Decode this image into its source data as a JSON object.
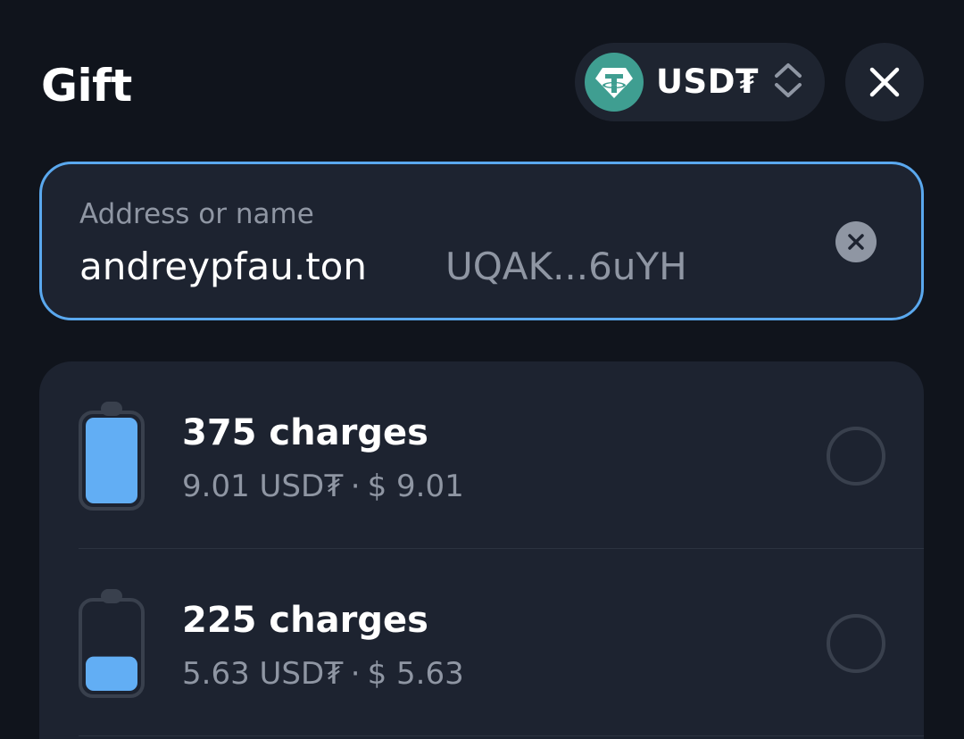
{
  "header": {
    "title": "Gift",
    "currency": "USD₮",
    "token_color": "#3f9e91",
    "currency_icon": "tether-icon",
    "switch_icon": "chevron-up-down-icon",
    "close_icon": "close-icon"
  },
  "address": {
    "placeholder": "Address or name",
    "name": "andreypfau.ton",
    "short_address": "UQAK...6uYH",
    "clear_icon": "clear-icon",
    "focus_color": "#5aa8ee"
  },
  "options": [
    {
      "title": "375 charges",
      "amount": "9.01 USD₮",
      "separator": "·",
      "fiat": "$ 9.01",
      "battery_level": 1.0,
      "selected": false
    },
    {
      "title": "225 charges",
      "amount": "5.63 USD₮",
      "separator": "·",
      "fiat": "$ 5.63",
      "battery_level": 0.4,
      "selected": false
    }
  ],
  "colors": {
    "background": "#10141c",
    "card": "#1d2330",
    "battery_fill": "#62aef4",
    "muted_text": "#8f96a3"
  }
}
